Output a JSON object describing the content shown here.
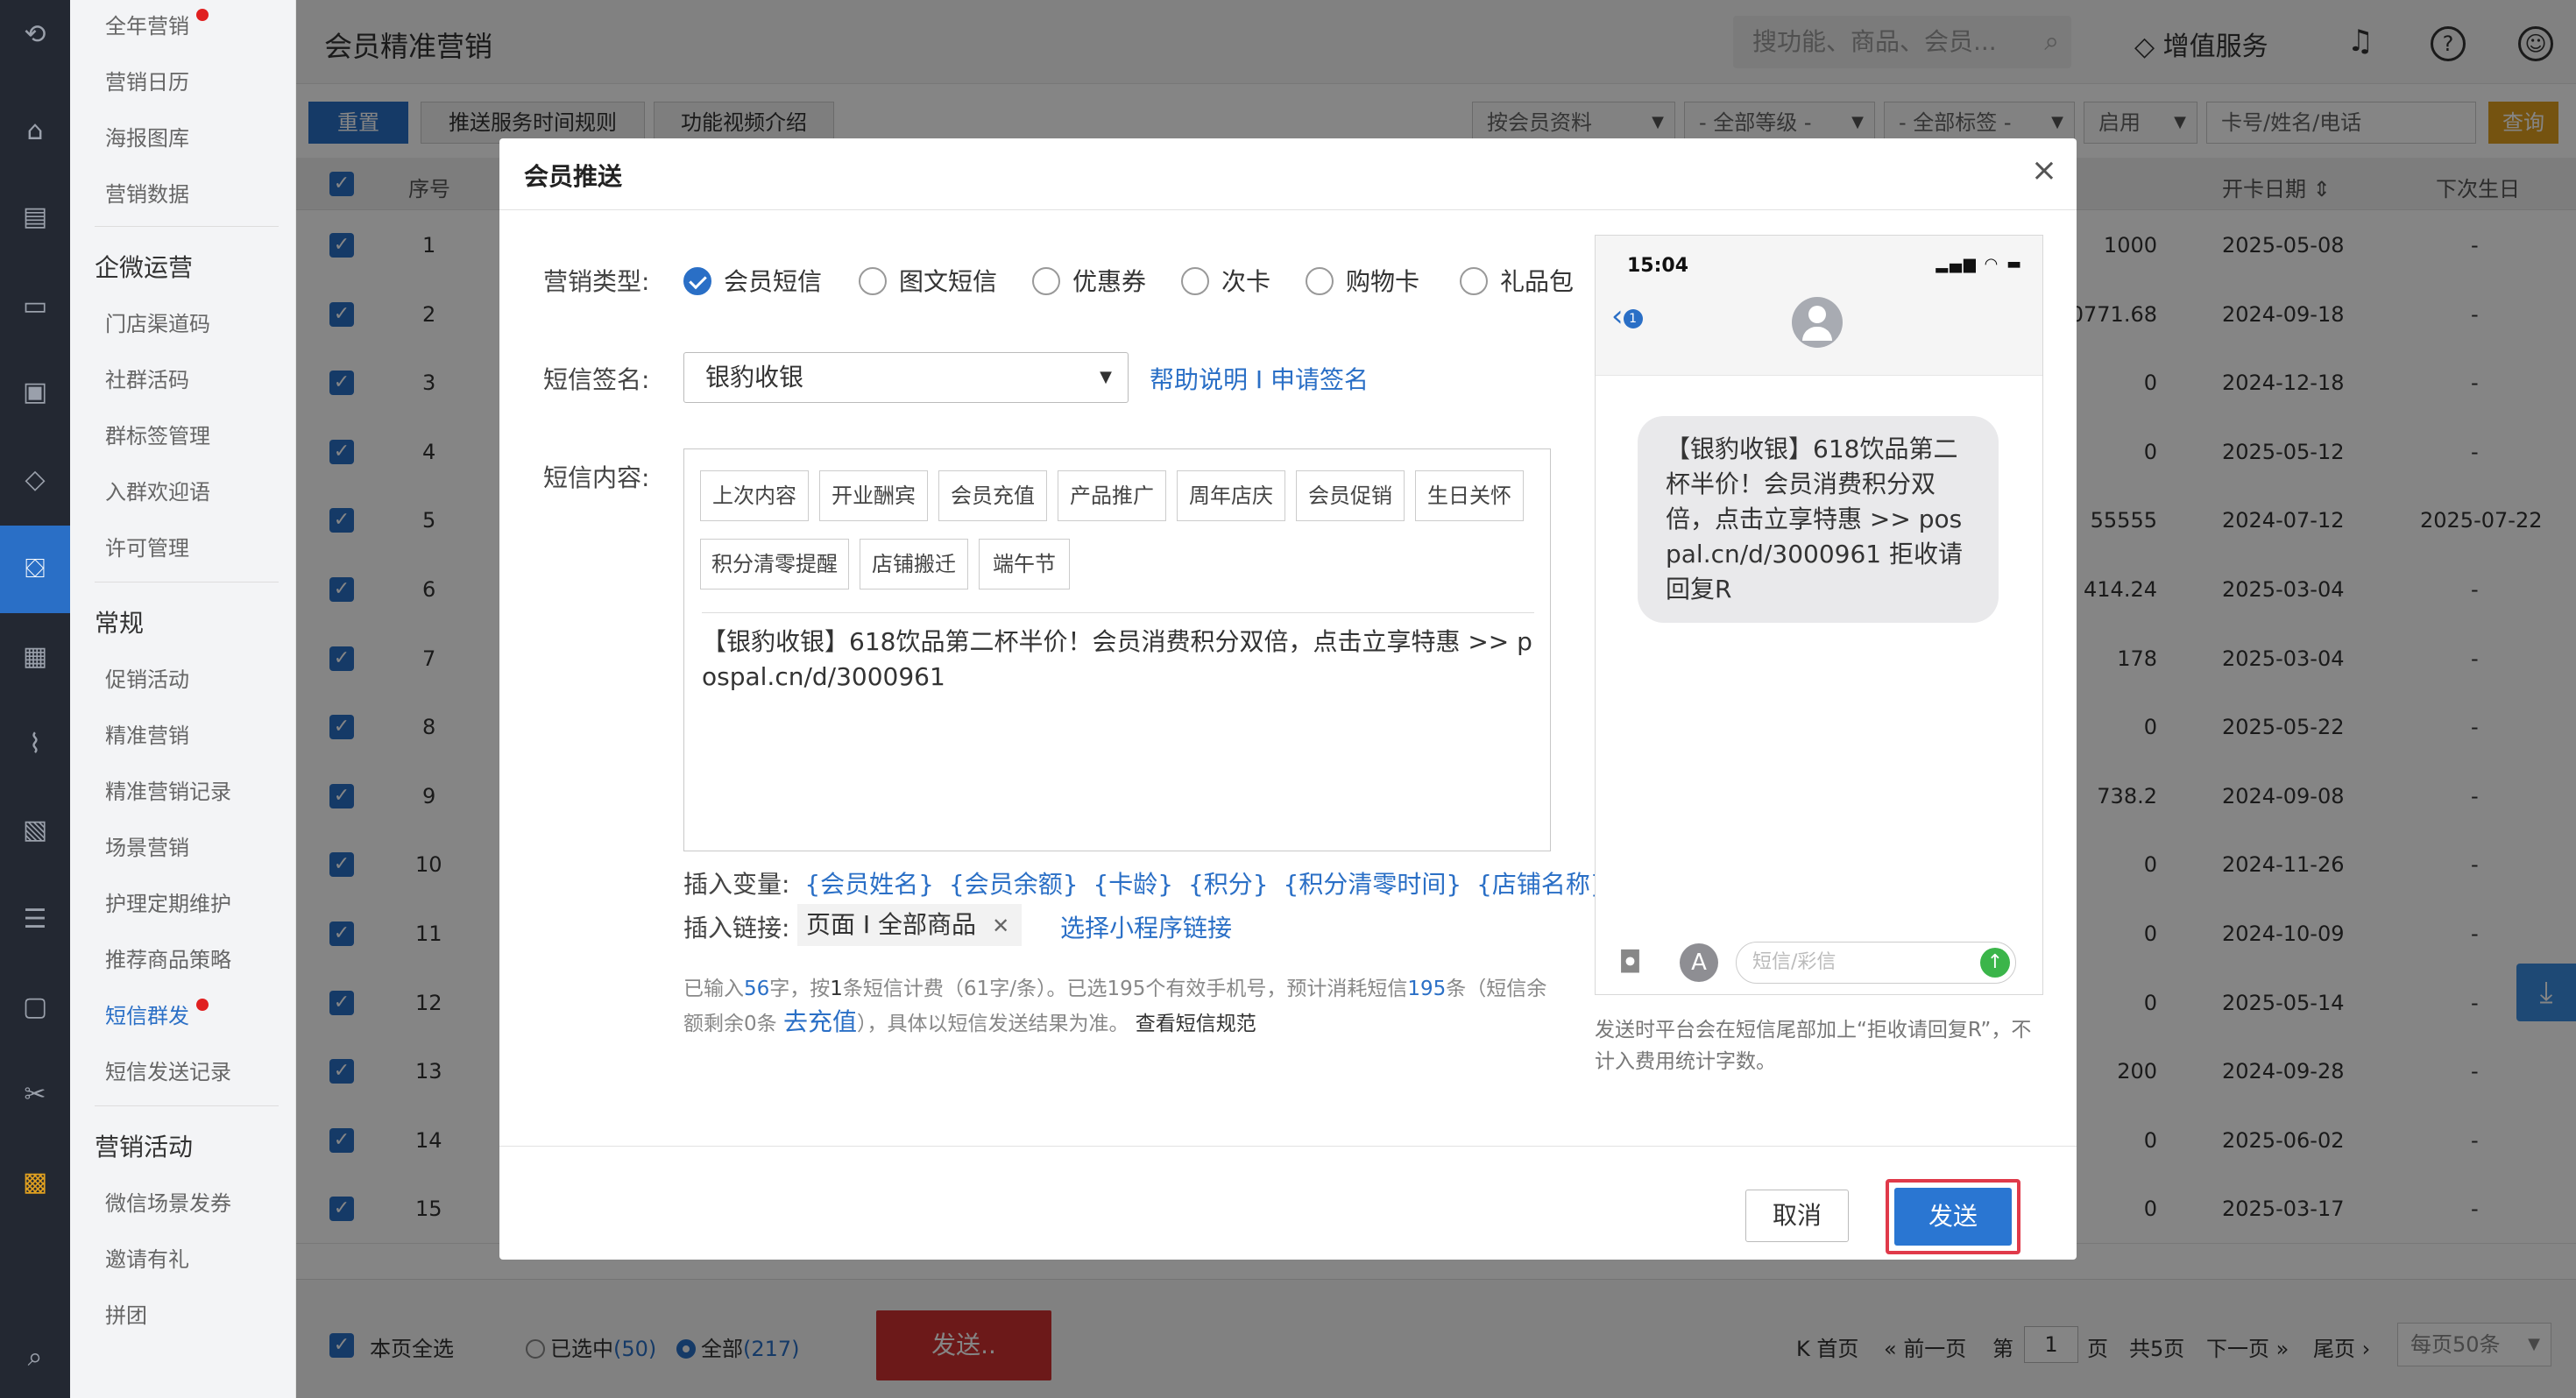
{
  "sidebar": {
    "items": [
      {
        "label": "全年营销",
        "dot": true
      },
      {
        "label": "营销日历"
      },
      {
        "label": "海报图库"
      },
      {
        "label": "营销数据"
      }
    ],
    "group_qiwei": "企微运营",
    "qiwei_items": [
      "门店渠道码",
      "社群活码",
      "群标签管理",
      "入群欢迎语",
      "许可管理"
    ],
    "group_changgui": "常规",
    "changgui_items": [
      "促销活动",
      "精准营销",
      "精准营销记录",
      "场景营销",
      "护理定期维护",
      "推荐商品策略",
      "短信群发",
      "短信发送记录"
    ],
    "group_huodong": "营销活动",
    "huodong_items": [
      "微信场景发券",
      "邀请有礼",
      "拼团"
    ]
  },
  "header": {
    "title": "会员精准营销",
    "search_placeholder": "搜功能、商品、会员...",
    "value_service": "增值服务"
  },
  "toolbar": {
    "reset": "重置",
    "push_rules": "推送服务时间规则",
    "video_intro": "功能视频介绍",
    "filters": [
      "按会员资料",
      "- 全部等级 -",
      "- 全部标签 -",
      "启用"
    ],
    "card_placeholder": "卡号/姓名/电话",
    "query": "查询"
  },
  "table": {
    "headers": {
      "seq": "序号",
      "open_date": "开卡日期",
      "next_birthday": "下次生日"
    },
    "rows": [
      {
        "seq": "1",
        "val": "1000",
        "date": "2025-05-08",
        "bday": "-"
      },
      {
        "seq": "2",
        "val": "0771.68",
        "date": "2024-09-18",
        "bday": "-"
      },
      {
        "seq": "3",
        "val": "0",
        "date": "2024-12-18",
        "bday": "-"
      },
      {
        "seq": "4",
        "val": "0",
        "date": "2025-05-12",
        "bday": "-"
      },
      {
        "seq": "5",
        "val": "55555",
        "date": "2024-07-12",
        "bday": "2025-07-22"
      },
      {
        "seq": "6",
        "val": "414.24",
        "date": "2025-03-04",
        "bday": "-"
      },
      {
        "seq": "7",
        "val": "178",
        "date": "2025-03-04",
        "bday": "-"
      },
      {
        "seq": "8",
        "val": "0",
        "date": "2025-05-22",
        "bday": "-"
      },
      {
        "seq": "9",
        "val": "738.2",
        "date": "2024-09-08",
        "bday": "-"
      },
      {
        "seq": "10",
        "val": "0",
        "date": "2024-11-26",
        "bday": "-"
      },
      {
        "seq": "11",
        "val": "0",
        "date": "2024-10-09",
        "bday": "-"
      },
      {
        "seq": "12",
        "val": "0",
        "date": "2025-05-14",
        "bday": "-"
      },
      {
        "seq": "13",
        "val": "200",
        "date": "2024-09-28",
        "bday": "-"
      },
      {
        "seq": "14",
        "val": "0",
        "date": "2025-06-02",
        "bday": "-"
      },
      {
        "seq": "15",
        "val": "0",
        "date": "2025-03-17",
        "bday": "-"
      }
    ]
  },
  "footer": {
    "select_page": "本页全选",
    "selected_label": "已选中",
    "selected_count": "(50)",
    "all_label": "全部",
    "all_count": "(217)",
    "send": "发送..",
    "first": "首页",
    "prev": "前一页",
    "page_prefix": "第",
    "page_num": "1",
    "page_suffix": "页",
    "total": "共5页",
    "next": "下一页",
    "last": "尾页",
    "per_page": "每页50条"
  },
  "modal": {
    "title": "会员推送",
    "type_label": "营销类型:",
    "types": [
      "会员短信",
      "图文短信",
      "优惠券",
      "次卡",
      "购物卡",
      "礼品包"
    ],
    "selected_type": "会员短信",
    "sign_label": "短信签名:",
    "sign_value": "银豹收银",
    "help_link": "帮助说明 I 申请签名",
    "content_label": "短信内容:",
    "templates": [
      "上次内容",
      "开业酬宾",
      "会员充值",
      "产品推广",
      "周年店庆",
      "会员促销",
      "生日关怀",
      "积分清零提醒",
      "店铺搬迁",
      "端午节"
    ],
    "content": "【银豹收银】618饮品第二杯半价！会员消费积分双倍，点击立享特惠 >> pospal.cn/d/3000961",
    "vars_label": "插入变量:",
    "vars": [
      "{会员姓名}",
      "{会员余额}",
      "{卡龄}",
      "{积分}",
      "{积分清零时间}",
      "{店铺名称}"
    ],
    "link_label": "插入链接:",
    "link_chip": "页面 I 全部商品",
    "mini_link": "选择小程序链接",
    "info": {
      "p1": "已输入",
      "chars": "56",
      "p2": "字，按",
      "count": "1",
      "p3": "条短信计费（61字/条）。已选195个有效手机号，预计消耗短信",
      "est": "195",
      "p4": "条（短信余额剩余0条",
      "recharge": "去充值",
      "p5": "），具体以短信发送结果为准。",
      "rules": "查看短信规范"
    },
    "phone": {
      "time": "15:04",
      "back_badge": "1",
      "message": "【银豹收银】618饮品第二杯半价！会员消费积分双倍，点击立享特惠 >> pospal.cn/d/3000961 拒收请回复R",
      "input_placeholder": "短信/彩信"
    },
    "note": "发送时平台会在短信尾部加上“拒收请回复R”，不计入费用统计字数。",
    "cancel": "取消",
    "send": "发送"
  }
}
